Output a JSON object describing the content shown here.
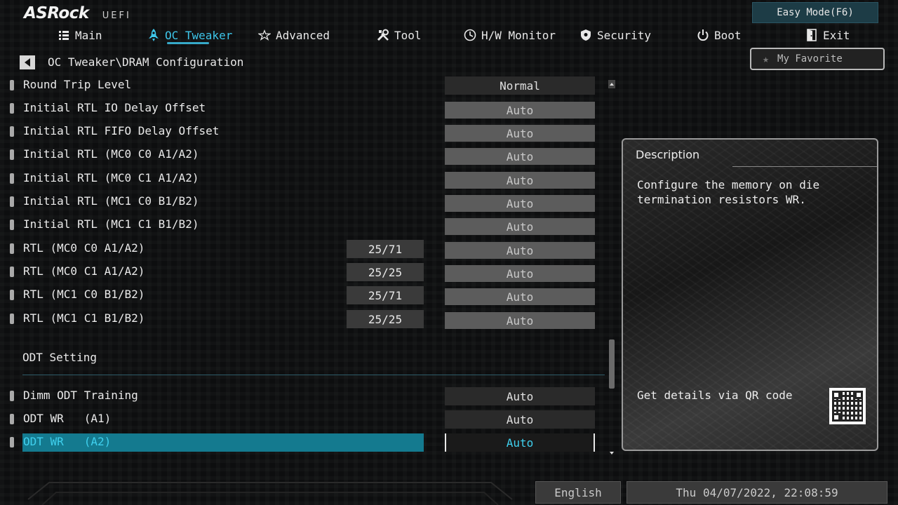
{
  "app": {
    "brand": "ASRock",
    "subtitle": "UEFI",
    "easy_mode_label": "Easy Mode(F6)"
  },
  "nav": [
    {
      "label": "Main",
      "icon": "list-icon",
      "active": false
    },
    {
      "label": "OC Tweaker",
      "icon": "rocket-icon",
      "active": true
    },
    {
      "label": "Advanced",
      "icon": "star-icon",
      "active": false
    },
    {
      "label": "Tool",
      "icon": "tools-icon",
      "active": false
    },
    {
      "label": "H/W Monitor",
      "icon": "monitor-icon",
      "active": false
    },
    {
      "label": "Security",
      "icon": "shield-icon",
      "active": false
    },
    {
      "label": "Boot",
      "icon": "power-icon",
      "active": false
    },
    {
      "label": "Exit",
      "icon": "exit-door-icon",
      "active": false
    }
  ],
  "breadcrumb": "OC Tweaker\\DRAM Configuration",
  "favorite_label": "My Favorite",
  "settings": [
    {
      "label": "Round Trip Level",
      "value": "Normal",
      "current": ""
    },
    {
      "label": "Initial RTL IO Delay Offset",
      "value": "Auto",
      "current": ""
    },
    {
      "label": "Initial RTL FIFO Delay Offset",
      "value": "Auto",
      "current": ""
    },
    {
      "label": "Initial RTL (MC0 C0 A1/A2)",
      "value": "Auto",
      "current": ""
    },
    {
      "label": "Initial RTL (MC0 C1 A1/A2)",
      "value": "Auto",
      "current": ""
    },
    {
      "label": "Initial RTL (MC1 C0 B1/B2)",
      "value": "Auto",
      "current": ""
    },
    {
      "label": "Initial RTL (MC1 C1 B1/B2)",
      "value": "Auto",
      "current": ""
    },
    {
      "label": "RTL (MC0 C0 A1/A2)",
      "value": "Auto",
      "current": "25/71"
    },
    {
      "label": "RTL (MC0 C1 A1/A2)",
      "value": "Auto",
      "current": "25/25"
    },
    {
      "label": "RTL (MC1 C0 B1/B2)",
      "value": "Auto",
      "current": "25/71"
    },
    {
      "label": "RTL (MC1 C1 B1/B2)",
      "value": "Auto",
      "current": "25/25"
    }
  ],
  "odt": {
    "heading": "ODT Setting",
    "settings": [
      {
        "label": "Dimm ODT Training",
        "value": "Auto"
      },
      {
        "label": "ODT WR   (A1)",
        "value": "Auto"
      },
      {
        "label": "ODT WR   (A2)",
        "value": "Auto"
      }
    ]
  },
  "description": {
    "title": "Description",
    "text": "Configure the memory on die termination resistors WR.",
    "qr_label": "Get details via QR code"
  },
  "footer": {
    "language": "English",
    "datetime": "Thu 04/07/2022, 22:08:59"
  },
  "colors": {
    "accent": "#3ec6ea",
    "selected_row": "#147a8f"
  }
}
